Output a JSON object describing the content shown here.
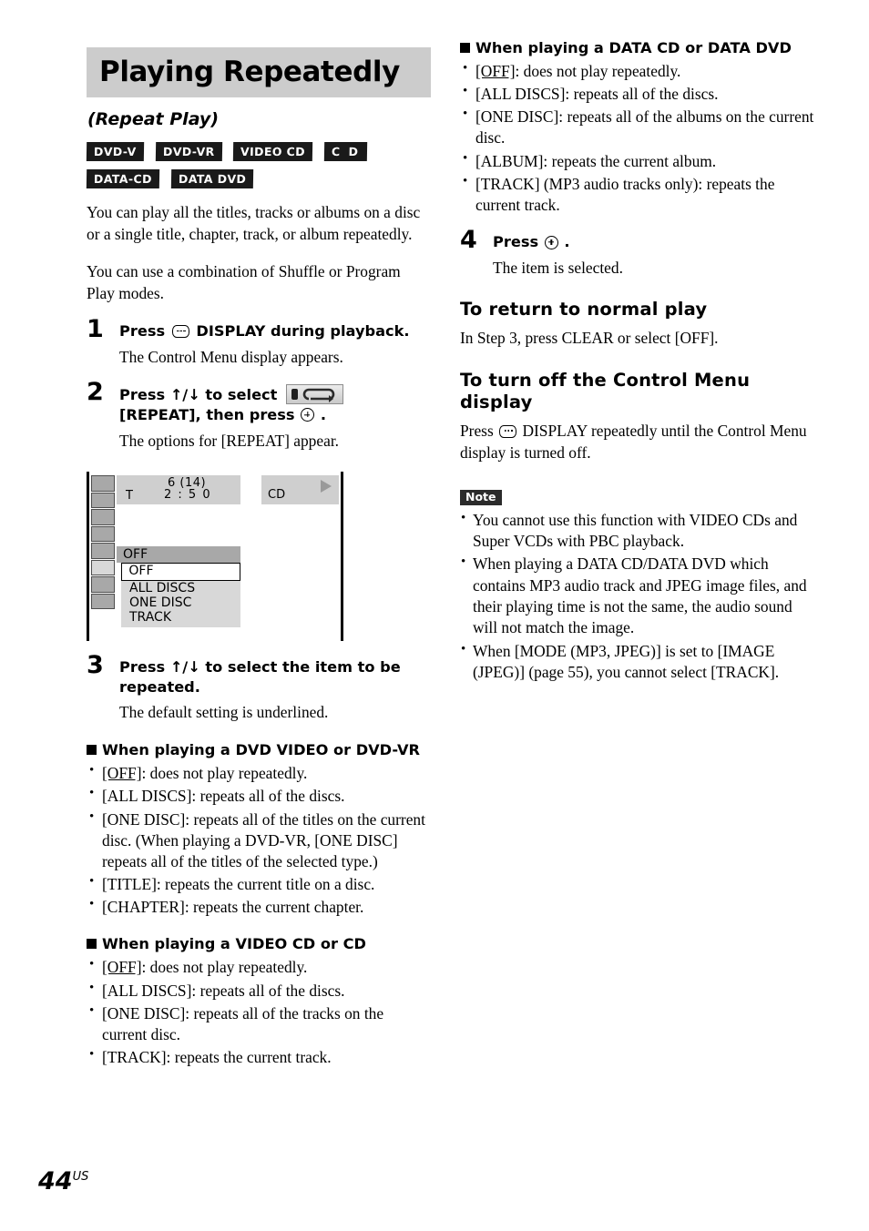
{
  "header": {
    "title": "Playing Repeatedly",
    "subtitle": "(Repeat Play)"
  },
  "badges": [
    {
      "label": "DVD-V"
    },
    {
      "label": "DVD-VR"
    },
    {
      "label": "VIDEO CD"
    },
    {
      "label": "C D"
    },
    {
      "label": "DATA-CD"
    },
    {
      "label": "DATA DVD"
    }
  ],
  "intro": {
    "p1": "You can play all the titles, tracks or albums on a disc or a single title, chapter, track, or album repeatedly.",
    "p2": "You can use a combination of Shuffle or Program Play modes."
  },
  "steps": {
    "step1": {
      "num": "1",
      "head_before": "Press",
      "head_after": "DISPLAY during playback.",
      "body": "The Control Menu display appears."
    },
    "step2": {
      "num": "2",
      "head_before": "Press ↑/↓ to select",
      "head_mid": "[REPEAT], then press",
      "head_after": ".",
      "body": "The options for [REPEAT] appear."
    },
    "step3": {
      "num": "3",
      "head": "Press ↑/↓ to select the item to be repeated.",
      "body": "The default setting is underlined."
    },
    "step4": {
      "num": "4",
      "head_before": "Press",
      "head_after": ".",
      "body": "The item is selected."
    }
  },
  "osd": {
    "info_line1": "6 (14)",
    "info_line2_label": "T",
    "info_line2_time": "2 : 5 0",
    "disc_label": "CD",
    "current": "OFF",
    "options": [
      "OFF",
      "ALL DISCS",
      "ONE DISC",
      "TRACK"
    ],
    "selected_index": 0,
    "icon_cells": 8,
    "active_cell_index": 5
  },
  "sections": {
    "dvd": {
      "heading": "When playing a DVD VIDEO or DVD-VR",
      "items": [
        {
          "key": "[OFF]",
          "underlined": true,
          "text": ": does not play repeatedly."
        },
        {
          "key": "[ALL DISCS]",
          "underlined": false,
          "text": ": repeats all of the discs."
        },
        {
          "key": "[ONE DISC]",
          "underlined": false,
          "text": ": repeats all of the titles on the current disc. (When playing a DVD-VR, [ONE DISC] repeats all of the titles of the selected type.)"
        },
        {
          "key": "[TITLE]",
          "underlined": false,
          "text": ": repeats the current title on a disc."
        },
        {
          "key": "[CHAPTER]",
          "underlined": false,
          "text": ": repeats the current chapter."
        }
      ]
    },
    "videocd": {
      "heading": "When playing a VIDEO CD or CD",
      "items": [
        {
          "key": "[OFF]",
          "underlined": true,
          "text": ": does not play repeatedly."
        },
        {
          "key": "[ALL DISCS]",
          "underlined": false,
          "text": ": repeats all of the discs."
        },
        {
          "key": "[ONE DISC]",
          "underlined": false,
          "text": ": repeats all of the tracks on the current disc."
        },
        {
          "key": "[TRACK]",
          "underlined": false,
          "text": ": repeats the current track."
        }
      ]
    },
    "datacd": {
      "heading": "When playing a DATA CD or DATA DVD",
      "items": [
        {
          "key": "[OFF]",
          "underlined": true,
          "text": ": does not play repeatedly."
        },
        {
          "key": "[ALL DISCS]",
          "underlined": false,
          "text": ": repeats all of the discs."
        },
        {
          "key": "[ONE DISC]",
          "underlined": false,
          "text": ": repeats all of the albums on the current disc."
        },
        {
          "key": "[ALBUM]",
          "underlined": false,
          "text": ": repeats the current album."
        },
        {
          "key": "[TRACK]",
          "underlined": false,
          "text": " (MP3 audio tracks only): repeats the current track."
        }
      ]
    }
  },
  "return_normal": {
    "heading": "To return to normal play",
    "body": "In Step 3, press CLEAR or select [OFF]."
  },
  "turn_off": {
    "heading": "To turn off the Control Menu display",
    "body_before": "Press",
    "body_after": "DISPLAY repeatedly until the Control Menu display is turned off."
  },
  "note": {
    "badge": "Note",
    "items": [
      "You cannot use this function with VIDEO CDs and Super VCDs with PBC playback.",
      "When playing a DATA CD/DATA DVD which contains MP3 audio track and JPEG image files, and their playing time is not the same, the audio sound will not match the image.",
      "When [MODE (MP3, JPEG)] is set to [IMAGE (JPEG)] (page 55), you cannot select [TRACK]."
    ]
  },
  "footer": {
    "page": "44",
    "region": "US"
  },
  "colors": {
    "banner_bg": "#cccccc",
    "badge_bg": "#1a1a1a",
    "osd_gray": "#cfcfcf",
    "osd_cell": "#a8a8a8"
  }
}
